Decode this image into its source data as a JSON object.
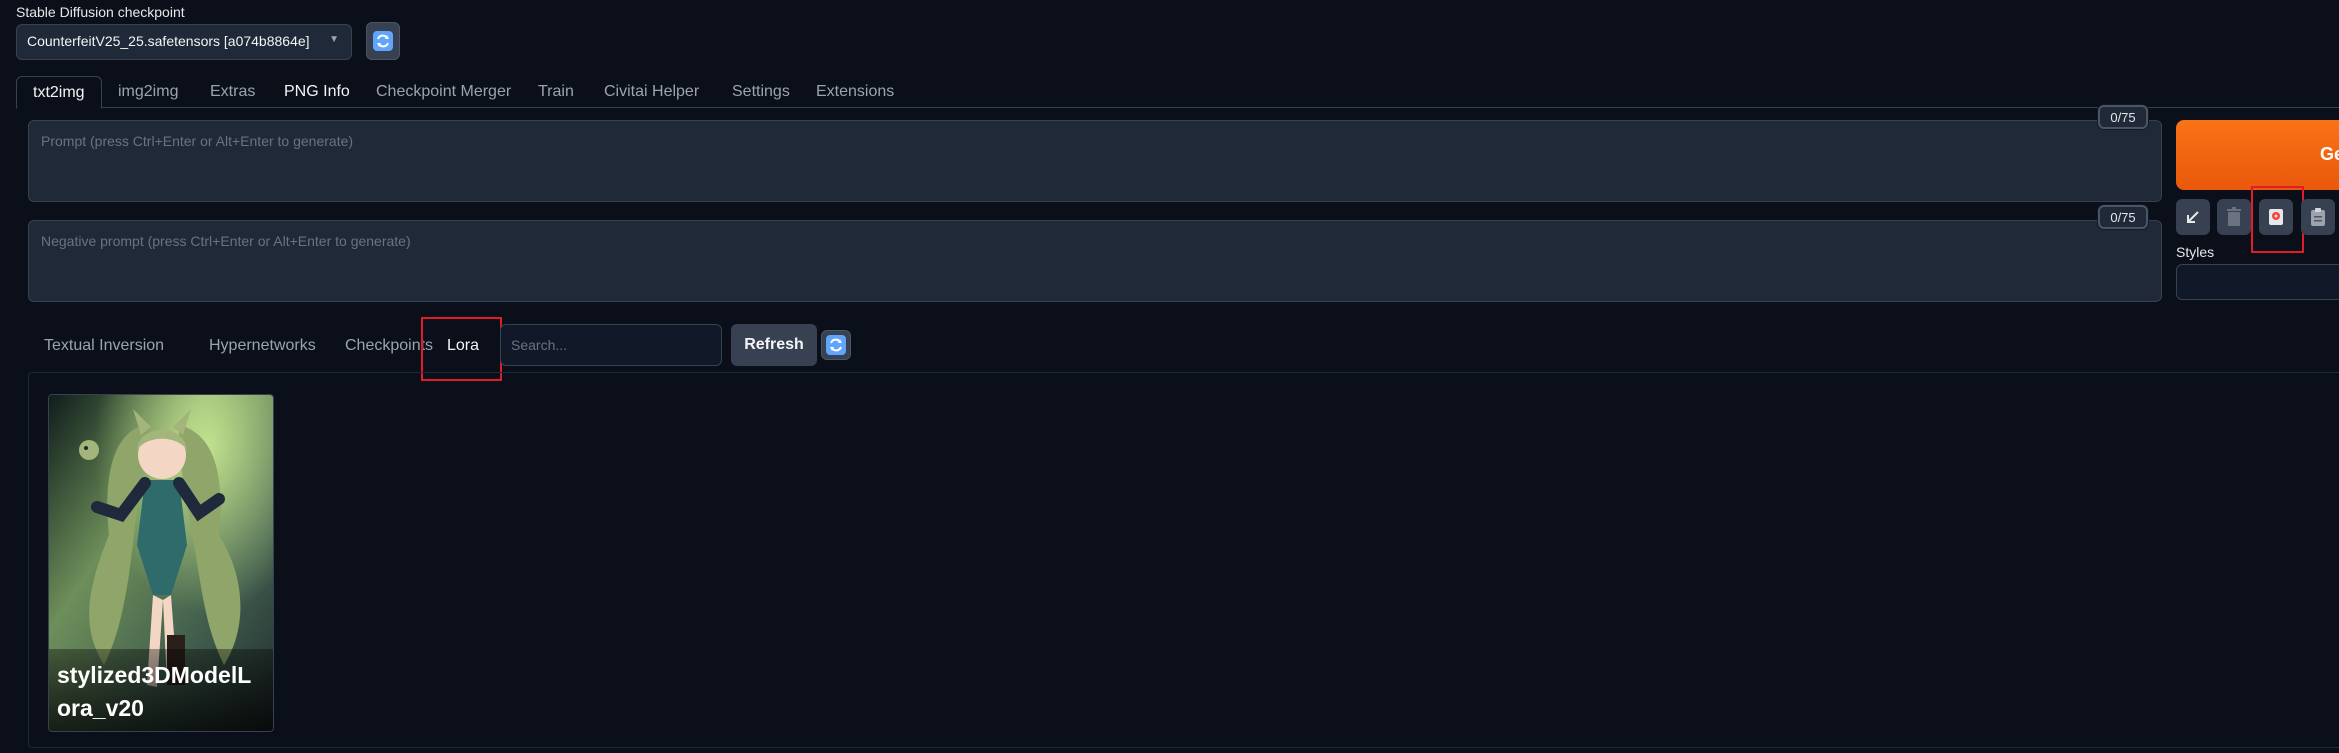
{
  "checkpoint": {
    "label": "Stable Diffusion checkpoint",
    "selected": "CounterfeitV25_25.safetensors [a074b8864e]"
  },
  "tabs": [
    {
      "label": "txt2img"
    },
    {
      "label": "img2img"
    },
    {
      "label": "Extras"
    },
    {
      "label": "PNG Info"
    },
    {
      "label": "Checkpoint Merger"
    },
    {
      "label": "Train"
    },
    {
      "label": "Civitai Helper"
    },
    {
      "label": "Settings"
    },
    {
      "label": "Extensions"
    }
  ],
  "prompt": {
    "placeholder": "Prompt (press Ctrl+Enter or Alt+Enter to generate)",
    "token_count": "0/75"
  },
  "negative_prompt": {
    "placeholder": "Negative prompt (press Ctrl+Enter or Alt+Enter to generate)",
    "token_count": "0/75"
  },
  "generate": {
    "label": "Ge"
  },
  "styles": {
    "label": "Styles"
  },
  "extra_networks": {
    "tabs": [
      {
        "label": "Textual Inversion"
      },
      {
        "label": "Hypernetworks"
      },
      {
        "label": "Checkpoints"
      },
      {
        "label": "Lora"
      }
    ],
    "search_placeholder": "Search...",
    "refresh_label": "Refresh",
    "cards": [
      {
        "name": "stylized3DModelLora_v20"
      }
    ]
  },
  "colors": {
    "background": "#0b0f19",
    "generate_accent": "#f97316",
    "highlight_box": "#e11d2a"
  }
}
